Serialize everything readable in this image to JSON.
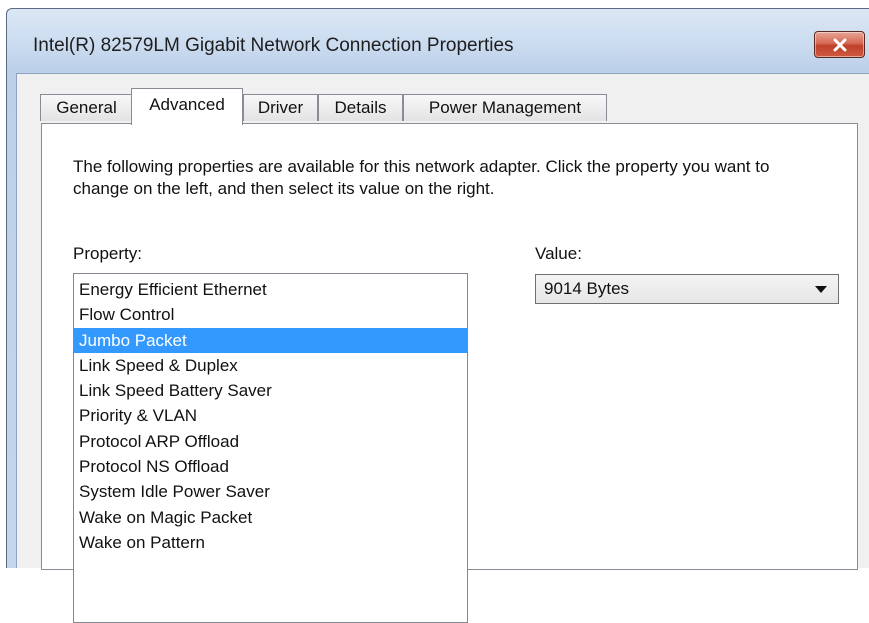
{
  "window": {
    "title": "Intel(R) 82579LM Gigabit Network Connection Properties"
  },
  "tabs": [
    {
      "label": "General",
      "selected": false
    },
    {
      "label": "Advanced",
      "selected": true
    },
    {
      "label": "Driver",
      "selected": false
    },
    {
      "label": "Details",
      "selected": false
    },
    {
      "label": "Power Management",
      "selected": false
    }
  ],
  "advanced": {
    "description": "The following properties are available for this network adapter. Click the property you want to change on the left, and then select its value on the right.",
    "property_label": "Property:",
    "value_label": "Value:",
    "properties": [
      "Energy Efficient Ethernet",
      "Flow Control",
      "Jumbo Packet",
      "Link Speed & Duplex",
      "Link Speed Battery Saver",
      "Priority & VLAN",
      "Protocol ARP Offload",
      "Protocol NS Offload",
      "System Idle Power Saver",
      "Wake on Magic Packet",
      "Wake on Pattern"
    ],
    "selected_property": "Jumbo Packet",
    "value": "9014 Bytes"
  },
  "colors": {
    "selection": "#3399ff",
    "close_button": "#c7432c"
  },
  "icons": {
    "close": "close-icon",
    "dropdown": "chevron-down-icon"
  }
}
